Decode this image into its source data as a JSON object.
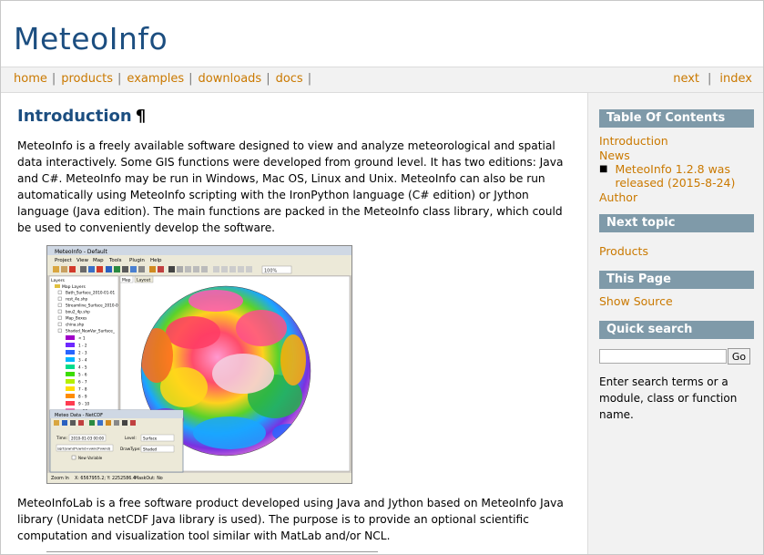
{
  "site": {
    "title": "MeteoInfo"
  },
  "nav": {
    "left": [
      {
        "label": "home"
      },
      {
        "label": "products"
      },
      {
        "label": "examples"
      },
      {
        "label": "downloads"
      },
      {
        "label": "docs"
      }
    ],
    "right": [
      {
        "label": "next"
      },
      {
        "label": "index"
      }
    ]
  },
  "content": {
    "heading": "Introduction",
    "pilcrow": "¶",
    "para1": "MeteoInfo is a freely available software designed to view and analyze meteorological and spatial data interactively. Some GIS functions were developed from ground level. It has two editions: Java and C#. MeteoInfo may be run in Windows, Mac OS, Linux and Unix. MeteoInfo can also be run automatically using MeteoInfo scripting with the IronPython language (C# edition) or Jython language (Java edition). The main functions are packed in the MeteoInfo class library, which could be used to conveniently develop the software.",
    "para2": "MeteoInfoLab is a free software product developed using Java and Jython based on MeteoInfo Java library (Unidata netCDF Java library is used). The purpose is to provide an optional scientific computation and visualization tool similar with MatLab and/or NCL."
  },
  "screenshot": {
    "window_title": "MeteoInfo - Default",
    "menu": [
      "Project",
      "View",
      "Map",
      "Tools",
      "Plugin",
      "Help"
    ],
    "zoom": "100%",
    "layers_title": "Layers",
    "tabs": [
      "Map",
      "Layout"
    ],
    "map_layers_label": "Map Layers",
    "layers": [
      "Bath_Surface_2010-01-01",
      "rest_4e.shp",
      "Streamline_Surface_2010-0",
      "bou2_4p.shp",
      "Map_Boxes",
      "china.shp",
      "Shaded_NewVar_Surface_"
    ],
    "legend": [
      {
        "label": "< 1",
        "color": "#a000c8"
      },
      {
        "label": "1 - 2",
        "color": "#6e28ff"
      },
      {
        "label": "2 - 3",
        "color": "#2864ff"
      },
      {
        "label": "3 - 4",
        "color": "#00b4ff"
      },
      {
        "label": "4 - 5",
        "color": "#00dc8c"
      },
      {
        "label": "5 - 6",
        "color": "#3cdc00"
      },
      {
        "label": "6 - 7",
        "color": "#b4f000"
      },
      {
        "label": "7 - 8",
        "color": "#ffdc00"
      },
      {
        "label": "8 - 9",
        "color": "#ff8c00"
      },
      {
        "label": "9 - 10",
        "color": "#ff3c50"
      },
      {
        "label": "> 10",
        "color": "#ff78b4"
      }
    ],
    "dialog": {
      "title": "Meteo Data - NetCDF",
      "time_label": "Time:",
      "time_value": "2010-01-03 00:00",
      "level_label": "Level:",
      "level_value": "Surface",
      "expr": "sqrt(uwnd*uwnd+vwnd*vwnd)",
      "drawtype_label": "DrawType:",
      "drawtype_value": "Shaded",
      "checkbox_label": "New Variable"
    },
    "status": {
      "zoom": "Zoom In",
      "coords": "X: 6567955.2; Y: 2252586.4",
      "mask": "MaskOut: No"
    }
  },
  "sidebar": {
    "toc_title": "Table Of Contents",
    "toc_intro": "Introduction",
    "toc_news": "News",
    "toc_news_item": "MeteoInfo 1.2.8 was released (2015-8-24)",
    "toc_author": "Author",
    "next_title": "Next topic",
    "next_link": "Products",
    "page_title": "This Page",
    "page_link": "Show Source",
    "search_title": "Quick search",
    "search_button": "Go",
    "search_help": "Enter search terms or a module, class or function name."
  }
}
